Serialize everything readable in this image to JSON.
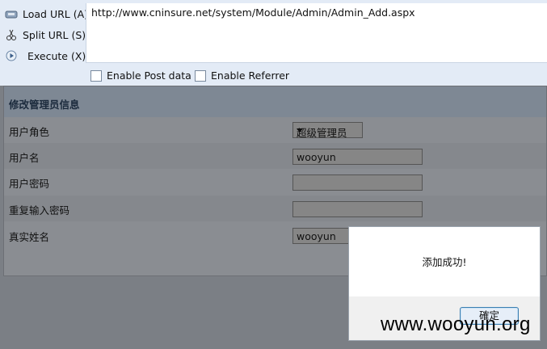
{
  "toolbar": {
    "commands": [
      {
        "label": "Load URL (A)",
        "icon": "load-url-icon"
      },
      {
        "label": "Split URL (S)",
        "icon": "split-url-icon"
      },
      {
        "label": "Execute (X)",
        "icon": "execute-icon"
      }
    ],
    "url": "http://www.cninsure.net/system/Module/Admin/Admin_Add.aspx",
    "options": [
      {
        "label": "Enable Post data",
        "checked": false
      },
      {
        "label": "Enable Referrer",
        "checked": false
      }
    ]
  },
  "form": {
    "title": "修改管理员信息",
    "rows": [
      {
        "label": "用户角色",
        "type": "select",
        "value": "超级管理员"
      },
      {
        "label": "用户名",
        "type": "text",
        "value": "wooyun"
      },
      {
        "label": "用户密码",
        "type": "password",
        "value": ""
      },
      {
        "label": "重复输入密码",
        "type": "password",
        "value": ""
      },
      {
        "label": "真实姓名",
        "type": "text",
        "value": "wooyun"
      }
    ]
  },
  "dialog": {
    "message": "添加成功!",
    "ok_label": "確定"
  },
  "watermark": "www.wooyun.org",
  "colors": {
    "toolbar_bg": "#e3ebf6",
    "overlay": "#7b7f85",
    "button_border": "#3c7fb1"
  }
}
